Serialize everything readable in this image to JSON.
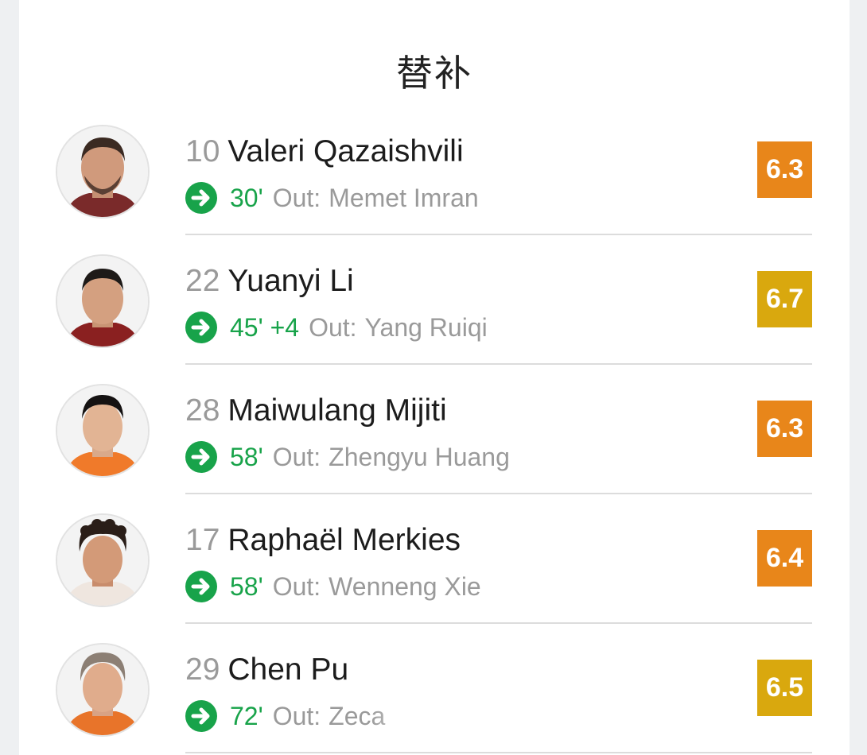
{
  "title": "替补",
  "subs": [
    {
      "number": "10",
      "name": "Valeri Qazaishvili",
      "minute": "30'",
      "out_label": "Out:",
      "out_name": "Memet Imran",
      "rating": "6.3",
      "rating_color": "#e8861a"
    },
    {
      "number": "22",
      "name": "Yuanyi Li",
      "minute": "45' +4",
      "out_label": "Out:",
      "out_name": "Yang Ruiqi",
      "rating": "6.7",
      "rating_color": "#d9a80e"
    },
    {
      "number": "28",
      "name": "Maiwulang Mijiti",
      "minute": "58'",
      "out_label": "Out:",
      "out_name": "Zhengyu Huang",
      "rating": "6.3",
      "rating_color": "#e8861a"
    },
    {
      "number": "17",
      "name": "Raphaël Merkies",
      "minute": "58'",
      "out_label": "Out:",
      "out_name": "Wenneng Xie",
      "rating": "6.4",
      "rating_color": "#e8861a"
    },
    {
      "number": "29",
      "name": "Chen Pu",
      "minute": "72'",
      "out_label": "Out:",
      "out_name": "Zeca",
      "rating": "6.5",
      "rating_color": "#d9a80e"
    }
  ],
  "colors": {
    "sub_green": "#18a34a",
    "muted": "#9a9a9a"
  }
}
